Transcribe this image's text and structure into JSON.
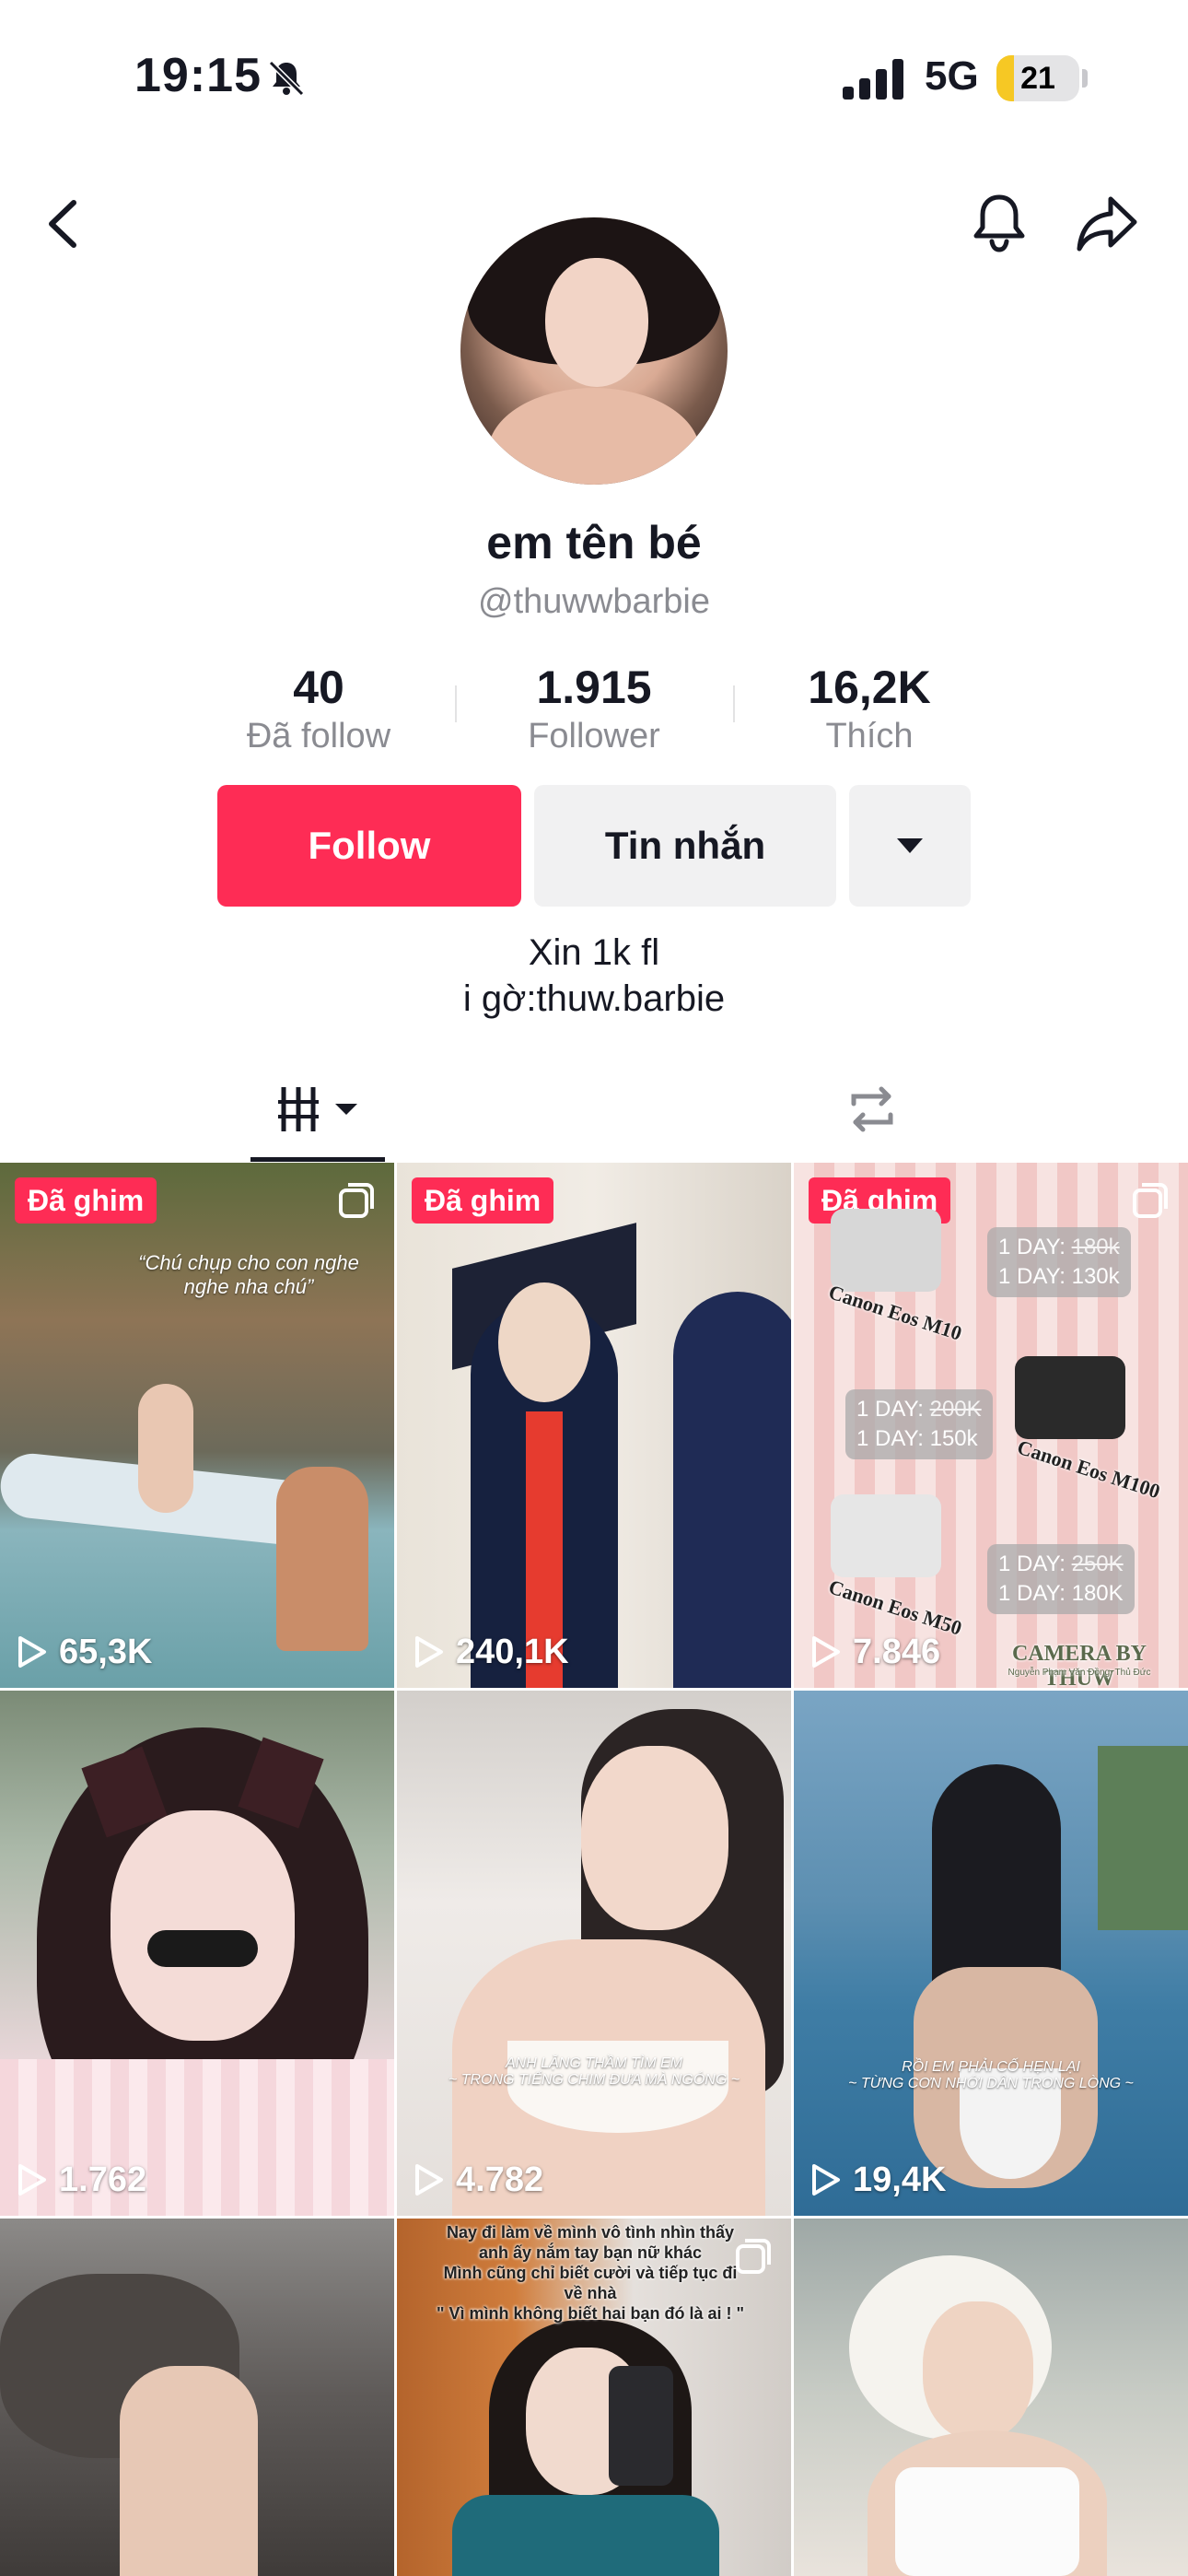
{
  "status_bar": {
    "time": "19:15",
    "network": "5G",
    "battery": "21",
    "battery_level": 0.21
  },
  "profile": {
    "display_name": "em tên bé",
    "username": "@thuwwbarbie",
    "stats": [
      {
        "value": "40",
        "label": "Đã follow"
      },
      {
        "value": "1.915",
        "label": "Follower"
      },
      {
        "value": "16,2K",
        "label": "Thích"
      }
    ],
    "buttons": {
      "follow": "Follow",
      "message": "Tin nhắn"
    },
    "bio": [
      "Xin 1k fl",
      "i gờ:thuw.barbie"
    ]
  },
  "tabs": [
    {
      "name": "videos",
      "icon": "grid-icon"
    },
    {
      "name": "reposts",
      "icon": "repost-icon"
    }
  ],
  "videos": [
    {
      "pinned": "Đã ghim",
      "views": "65,3K",
      "caption": "“Chú chụp cho con nghe\nnghe nha chú”"
    },
    {
      "pinned": "Đã ghim",
      "views": "240,1K"
    },
    {
      "pinned": "Đã ghim",
      "views": "7.846",
      "promo": {
        "chips": [
          {
            "line1": "1 DAY:",
            "old": "180k",
            "line2": "1 DAY: 130k"
          },
          {
            "line1": "1 DAY:",
            "old": "200K",
            "line2": "1 DAY: 150k"
          },
          {
            "line1": "1 DAY:",
            "old": "250K",
            "line2": "1 DAY: 180K"
          }
        ],
        "camera_labels": [
          "Canon Eos M10",
          "Canon Eos M100",
          "Canon Eos M50"
        ],
        "brand": "CAMERA BY THUW",
        "address": "Nguyễn Phạm Văn Đồng, Thủ Đức"
      }
    },
    {
      "views": "1.762"
    },
    {
      "views": "4.782",
      "caption": "ANH LẶNG THẦM TÌM EM\n~ TRONG TIẾNG CHIM ĐƯA MÀ NGÓNG ~"
    },
    {
      "views": "19,4K",
      "caption": "RỒI EM PHẢI CỐ HẸN LẠI\n~ TỪNG CƠN NHỚI DÂN TRONG LÒNG ~"
    },
    {},
    {
      "caption": "Nay đi làm về mình vô tình nhìn thấy\nanh ấy nắm tay bạn nữ khác\nMình cũng chỉ biết cười và tiếp tục đi\nvề nhà\n\" Vì mình không biết hai bạn đó là ai ! \""
    },
    {}
  ]
}
